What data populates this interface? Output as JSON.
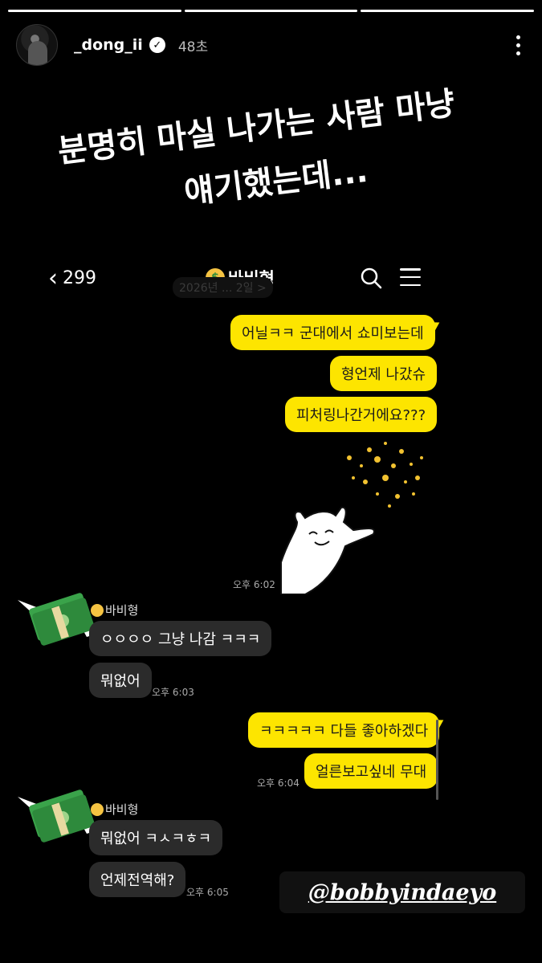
{
  "story": {
    "username": "_dong_ii",
    "time_ago": "48초",
    "progress": [
      1,
      1,
      0
    ],
    "caption_line1": "분명히 마실 나가는 사람 마냥",
    "caption_line2": "얘기했는데...",
    "mention": "@bobbyindaeyo"
  },
  "chat": {
    "back_count": "299",
    "room_name": "바비형",
    "date_pill": "2026년 ... 2일 >",
    "messages": [
      {
        "from": "me",
        "text": "어닐ㅋㅋ 군대에서 쇼미보는데"
      },
      {
        "from": "me",
        "text": "형언제 나갔슈"
      },
      {
        "from": "me",
        "text": "피처링나간거에요???"
      },
      {
        "from": "me",
        "type": "emoticon",
        "time": "오후 6:02"
      },
      {
        "from": "them",
        "text": "ㅇㅇㅇㅇ 그냥 나감 ㅋㅋㅋ"
      },
      {
        "from": "them",
        "text": "뭐없어",
        "time": "오후 6:03"
      },
      {
        "from": "me",
        "text": "ㅋㅋㅋㅋㅋ 다들 좋아하겠다"
      },
      {
        "from": "me",
        "text": "얼른보고싶네 무대",
        "time": "오후 6:04"
      },
      {
        "from": "them",
        "text": "뭐없어 ㅋㅅㅋㅎㅋ"
      },
      {
        "from": "them",
        "text": "언제전역해?",
        "time": "오후 6:05"
      }
    ],
    "sender_label": "바비형"
  },
  "colors": {
    "my_bubble": "#fde500",
    "their_bubble": "#2b2b2b",
    "background": "#000000"
  }
}
